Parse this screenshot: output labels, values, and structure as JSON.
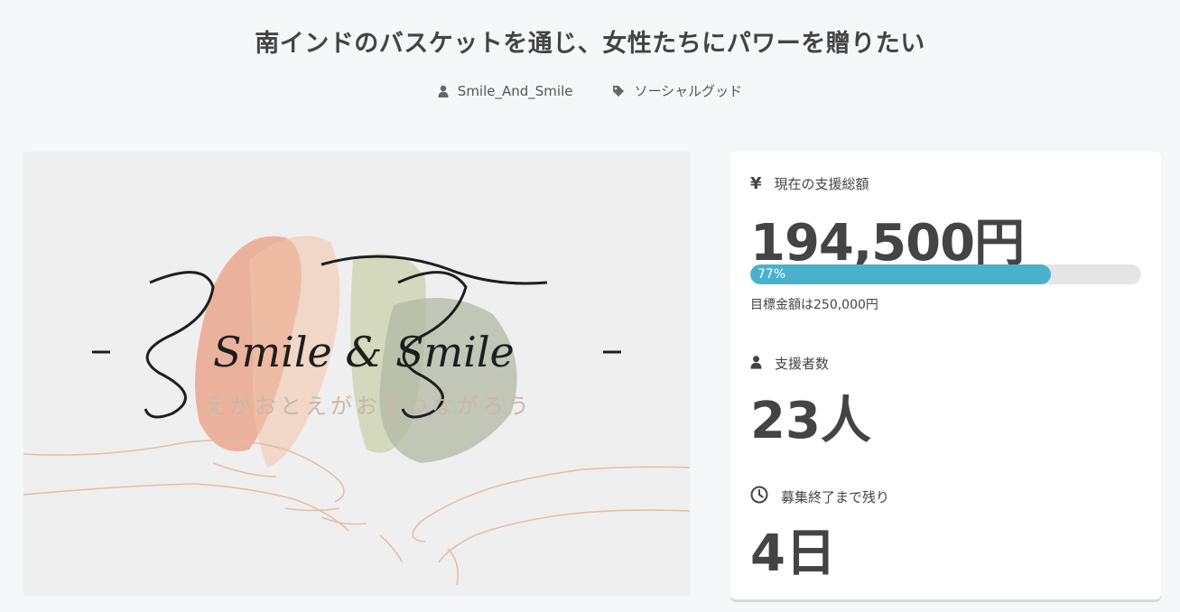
{
  "project": {
    "title": "南インドのバスケットを通じ、女性たちにパワーを贈りたい",
    "owner": "Smile_And_Smile",
    "category": "ソーシャルグッド"
  },
  "hero_image": {
    "logo_text": "Smile & Smile",
    "logo_subtitle": "えがおとえがおでつながろう"
  },
  "stats": {
    "amount_label": "現在の支援総額",
    "amount_value": "194,500円",
    "progress_text": "77%",
    "progress_fraction": 0.77,
    "goal_text": "目標金額は250,000円",
    "backers_label": "支援者数",
    "backers_value": "23人",
    "remaining_label": "募集終了まで残り",
    "remaining_value": "4日"
  },
  "icons": {
    "owner": "user-icon",
    "category": "tag-icon",
    "amount": "yen-icon",
    "backers": "user-icon",
    "remaining": "clock-icon"
  },
  "colors": {
    "background": "#f6f7f9",
    "accent": "#4ab1cc",
    "text": "#444444"
  }
}
